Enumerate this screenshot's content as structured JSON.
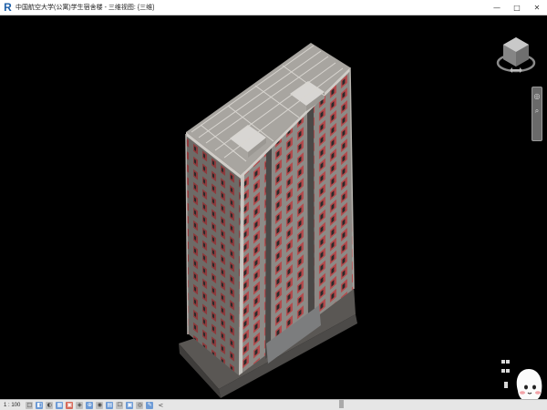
{
  "window": {
    "title": "中国航空大学(公寓)学生宿舍楼 - 三维视图: {三维}",
    "minimize": "—",
    "maximize": "□",
    "close": "✕",
    "app_icon_letter": "R"
  },
  "viewport": {
    "background": "#000000",
    "building_colors": {
      "brick": "#b44a4c",
      "concrete": "#8d8a86",
      "dark_column": "#4a4846",
      "frame": "#bdbab5",
      "window_glass": "#2b2b2b"
    }
  },
  "viewcube": {
    "icon": "viewcube-icon"
  },
  "navbar": {
    "steering_wheel_icon": "◎",
    "zoom_icon": "⌕"
  },
  "statusbar": {
    "scale": "1 : 100",
    "icons": [
      "□",
      "◧",
      "◐",
      "▦",
      "▣",
      "◈",
      "⊕",
      "◉",
      "▤",
      "☐",
      "▣",
      "◎",
      "✎"
    ],
    "arrow": "<"
  },
  "mascot": {
    "icon": "ghost-mascot-icon"
  }
}
